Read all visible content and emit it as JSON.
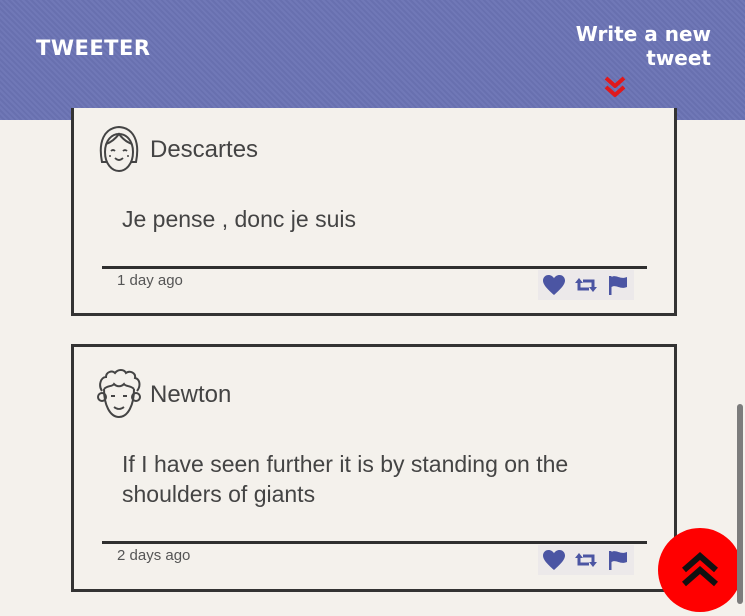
{
  "header": {
    "logo": "TWEETER",
    "compose_label": "Write a new tweet",
    "compose_icon": "double-chevron-down-icon",
    "accent_color": "#e0191c",
    "background_color": "#6b74b5"
  },
  "tweets": [
    {
      "user_name": "Descartes",
      "avatar": "girl-avatar-icon",
      "content": "Je pense , donc je suis",
      "timestamp": "1 day ago",
      "actions": [
        "heart-icon",
        "retweet-icon",
        "flag-icon"
      ]
    },
    {
      "user_name": "Newton",
      "avatar": "curly-hair-avatar-icon",
      "content": "If I have seen further it is by standing on the shoulders of giants",
      "timestamp": "2 days ago",
      "actions": [
        "heart-icon",
        "retweet-icon",
        "flag-icon"
      ]
    }
  ],
  "scroll_top": {
    "icon": "double-chevron-up-icon",
    "color": "#ff0000"
  },
  "action_icon_color": "#4b55a3"
}
